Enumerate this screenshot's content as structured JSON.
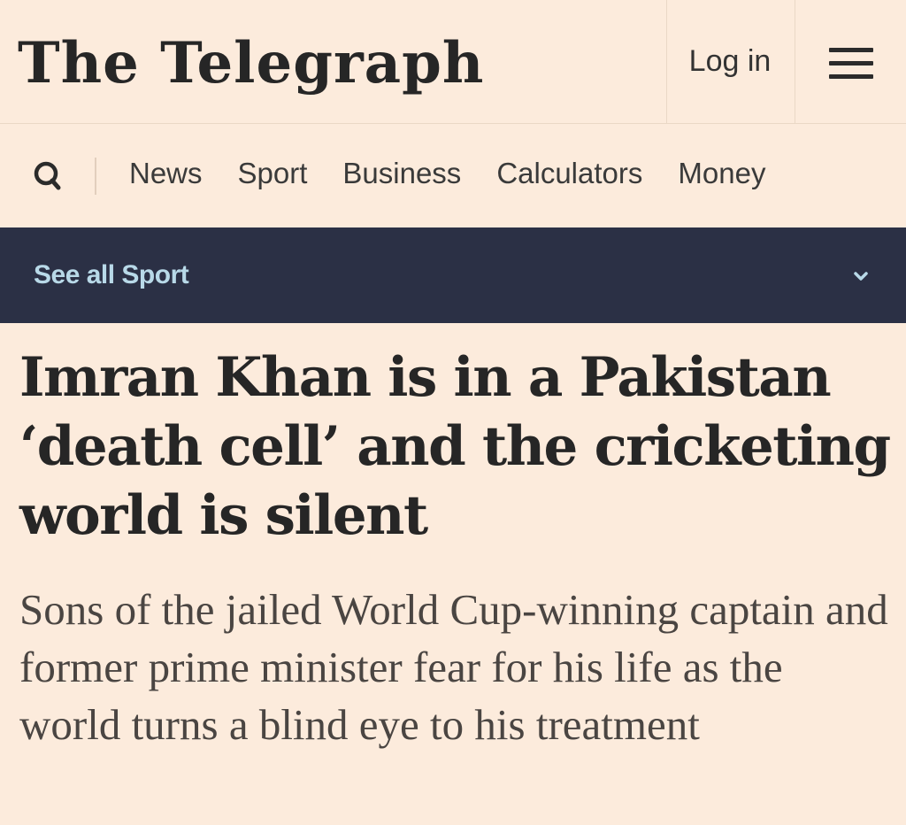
{
  "header": {
    "logo_text": "The Telegraph",
    "login_label": "Log in",
    "menu_icon": "hamburger-menu-icon",
    "search_icon": "search-icon"
  },
  "nav": {
    "items": [
      "News",
      "Sport",
      "Business",
      "Calculators",
      "Money"
    ]
  },
  "section_bar": {
    "label": "See all Sport",
    "chevron_icon": "chevron-down-icon",
    "background": "#2b3045",
    "label_color": "#b8d9e8"
  },
  "article": {
    "headline": "Imran Khan is in a Pakistan ‘death cell’ and the cricketing world is silent",
    "standfirst": "Sons of the jailed World Cup-winning captain and former prime minister fear for his life as the world turns a blind eye to his treatment"
  },
  "colors": {
    "page_background": "#fcebdc",
    "text": "#262626"
  }
}
